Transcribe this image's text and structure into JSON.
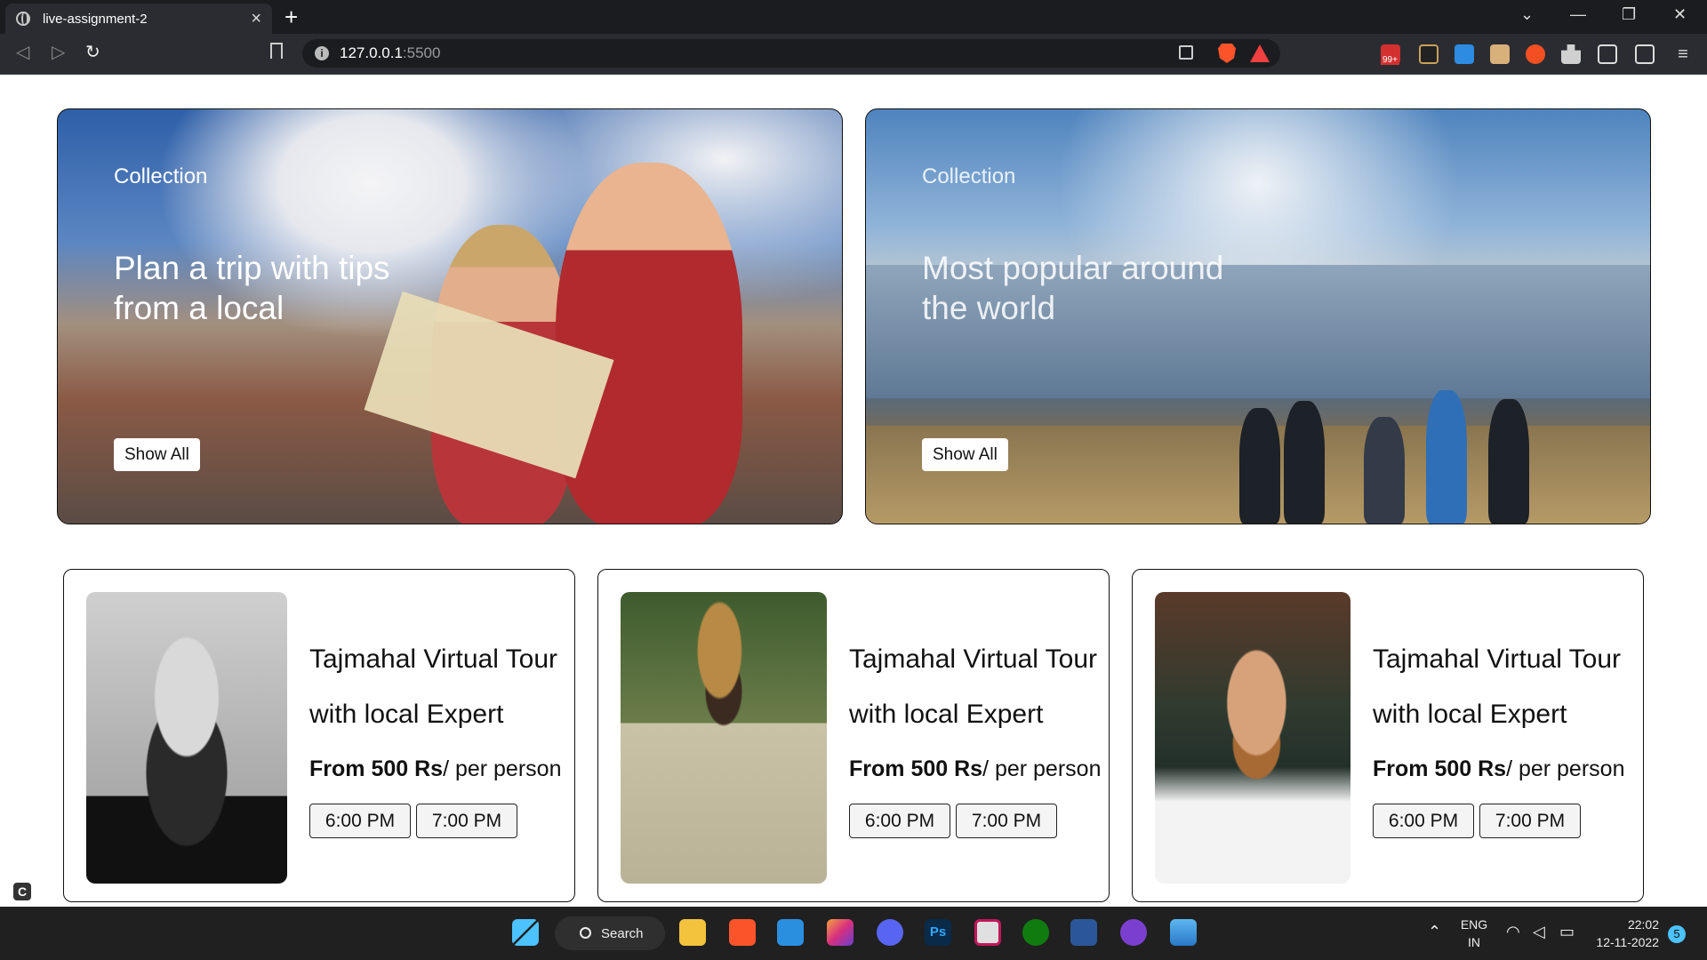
{
  "browser": {
    "tab_title": "live-assignment-2",
    "url_host": "127.0.0.1",
    "url_port": ":5500"
  },
  "heroes": [
    {
      "kicker": "Collection",
      "headline": "Plan a trip with tips from a local",
      "button": "Show All"
    },
    {
      "kicker": "Collection",
      "headline": "Most popular around the world",
      "button": "Show All"
    }
  ],
  "tours": [
    {
      "title_line1": "Tajmahal Virtual Tour",
      "title_line2": "with local Expert",
      "price_bold": "From 500 Rs",
      "price_rest": "/ per person",
      "times": [
        "6:00 PM",
        "7:00 PM"
      ]
    },
    {
      "title_line1": "Tajmahal Virtual Tour",
      "title_line2": "with local Expert",
      "price_bold": "From 500 Rs",
      "price_rest": "/ per person",
      "times": [
        "6:00 PM",
        "7:00 PM"
      ]
    },
    {
      "title_line1": "Tajmahal Virtual Tour",
      "title_line2": "with local Expert",
      "price_bold": "From 500 Rs",
      "price_rest": "/ per person",
      "times": [
        "6:00 PM",
        "7:00 PM"
      ]
    }
  ],
  "taskbar": {
    "search_label": "Search",
    "lang_line1": "ENG",
    "lang_line2": "IN",
    "time": "22:02",
    "date": "12-11-2022",
    "notification_count": "5"
  },
  "extension_badge": "99+",
  "colors": {
    "accent": "#4cc2ff",
    "brave": "#fb542b",
    "chrome_bg": "#2b2c31",
    "taskbar_bg": "#202020"
  }
}
